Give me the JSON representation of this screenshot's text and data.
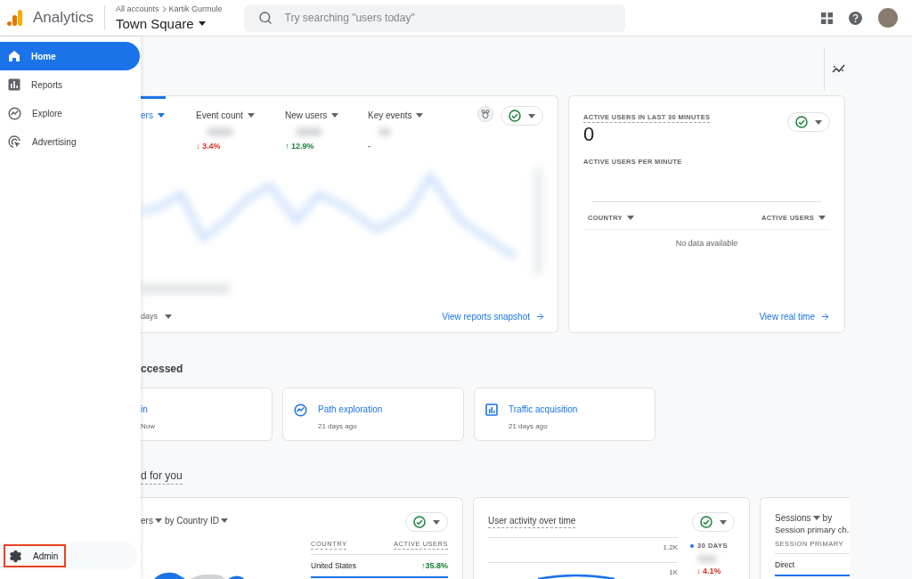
{
  "header": {
    "product": "Analytics",
    "breadcrumb": [
      "All accounts",
      "Kartik Gurmule"
    ],
    "property": "Town Square",
    "search": {
      "placeholder": "Try searching \"users today\""
    }
  },
  "sidebar": {
    "items": [
      {
        "label": "Home",
        "kind": "home",
        "selected": true
      },
      {
        "label": "Reports",
        "kind": "reports",
        "selected": false
      },
      {
        "label": "Explore",
        "kind": "explore",
        "selected": false
      },
      {
        "label": "Advertising",
        "kind": "advertising",
        "selected": false
      }
    ],
    "footer_item": {
      "label": "Admin",
      "outlined": true
    }
  },
  "reports_card": {
    "metrics": [
      {
        "label": "ers",
        "selected": true
      },
      {
        "label": "Event count",
        "selected": false,
        "change": "↓ 3.4%",
        "color": "#d93025"
      },
      {
        "label": "New users",
        "selected": false,
        "change": "↑ 12.9%",
        "color": "#188038"
      },
      {
        "label": "Key events",
        "selected": false,
        "change": "-"
      }
    ],
    "date_range": "days",
    "link": "View reports snapshot"
  },
  "realtime_card": {
    "title": "ACTIVE USERS IN LAST 30 MINUTES",
    "value": "0",
    "subtitle": "ACTIVE USERS PER MINUTE",
    "columns": [
      "COUNTRY",
      "ACTIVE USERS"
    ],
    "empty": "No data available",
    "link": "View real time"
  },
  "recent": {
    "heading": "ccessed",
    "items": [
      {
        "title": "in",
        "time": "Now",
        "kind": "none"
      },
      {
        "title": "Path exploration",
        "time": "21 days ago",
        "kind": "explore"
      },
      {
        "title": "Traffic acquisition",
        "time": "21 days ago",
        "kind": "report"
      }
    ]
  },
  "suggested": {
    "heading": "d for you",
    "country_card": {
      "metric": "ers",
      "dimension": "by Country ID",
      "columns": [
        "COUNTRY",
        "ACTIVE USERS"
      ],
      "rows": [
        {
          "country": "United States",
          "change": "↑35.8%",
          "color": "#188038"
        }
      ]
    },
    "activity_card": {
      "title": "User activity over time",
      "axis_labels": [
        "1.2K",
        "1K"
      ],
      "legend": "30 DAYS",
      "change": "↓ 4.1%",
      "color": "#d93025"
    },
    "sessions_card": {
      "metric": "Sessions",
      "joiner": "by",
      "dimension": "Session primary ch.",
      "column": "SESSION PRIMARY",
      "rows": [
        "Direct"
      ]
    }
  }
}
